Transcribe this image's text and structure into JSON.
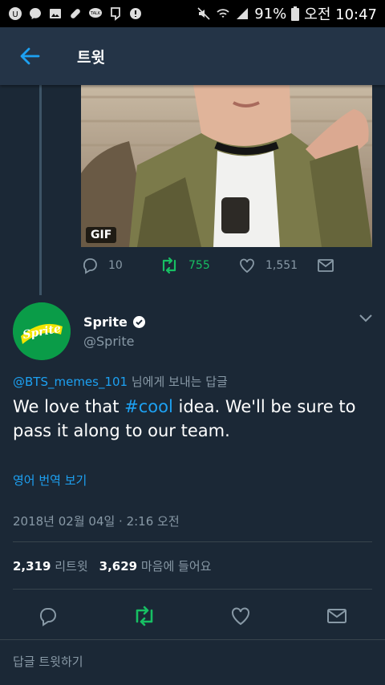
{
  "status_bar": {
    "battery": "91%",
    "time": "오전 10:47",
    "left_icons": [
      "notification-icon",
      "messenger-icon",
      "gallery-icon",
      "link-icon",
      "talk-icon",
      "flag-icon",
      "shield-icon"
    ],
    "right_icons": [
      "mute-icon",
      "wifi-icon",
      "signal-icon",
      "battery-icon"
    ]
  },
  "appbar": {
    "title": "트윗",
    "back_icon": "arrow-left-icon"
  },
  "parent_tweet": {
    "gif_label": "GIF",
    "replies": "10",
    "retweets": "755",
    "likes": "1,551"
  },
  "tweet": {
    "name": "Sprite",
    "verified": true,
    "handle": "@Sprite",
    "avatar_text": "Sprite",
    "replying_to_mention": "@BTS_memes_101",
    "replying_to_suffix": " 님에게 보내는 답글",
    "text_before": "We love that ",
    "hashtag": "#cool",
    "text_after": " idea. We'll be sure to pass it along to our team.",
    "translate": "영어 번역 보기",
    "timestamp": "2018년 02월 04일 · 2:16 오전",
    "retweet_count": "2,319",
    "retweet_label": "리트윗",
    "like_count": "3,629",
    "like_label": "마음에 들어요"
  },
  "reply_bar": {
    "placeholder": "답글 트윗하기"
  },
  "colors": {
    "accent": "#1da1f2",
    "retweet_green": "#17bf63",
    "background": "#1b2836",
    "header": "#243447",
    "muted": "#8899a6"
  }
}
